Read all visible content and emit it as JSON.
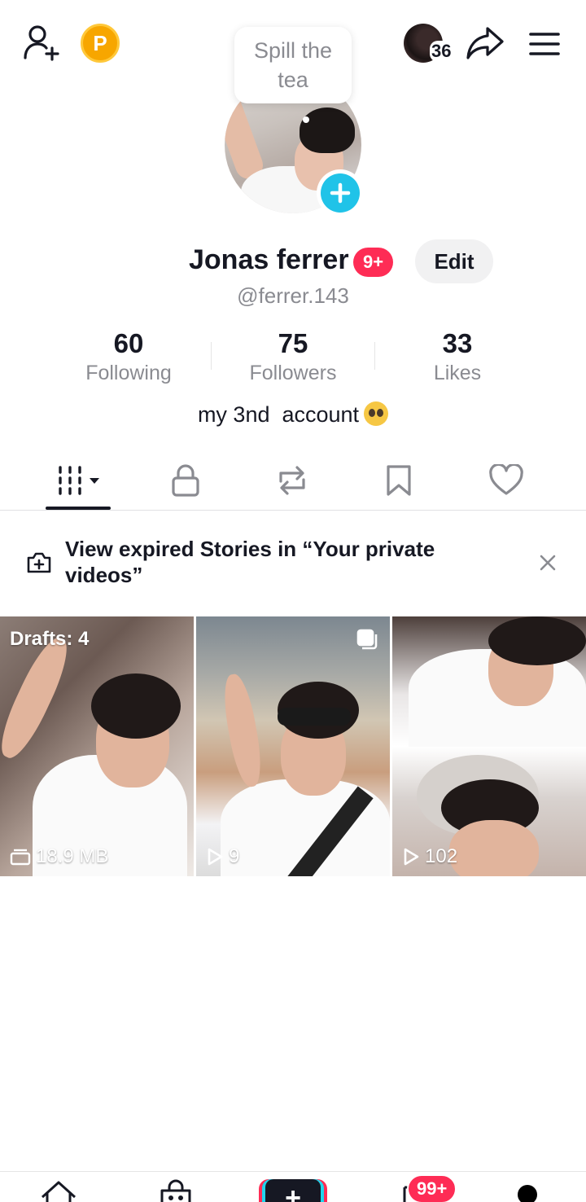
{
  "header": {
    "coin_letter": "P",
    "story_count": "36"
  },
  "tooltip": {
    "text": "Spill the tea"
  },
  "profile": {
    "name": "Jonas ferrer",
    "notification_badge": "9+",
    "edit_label": "Edit",
    "handle": "@ferrer.143",
    "bio": "my 3nd  account"
  },
  "stats": [
    {
      "value": "60",
      "label": "Following"
    },
    {
      "value": "75",
      "label": "Followers"
    },
    {
      "value": "33",
      "label": "Likes"
    }
  ],
  "tabs": [
    {
      "icon": "grid-icon",
      "selected": true
    },
    {
      "icon": "lock-icon"
    },
    {
      "icon": "repost-icon"
    },
    {
      "icon": "bookmark-icon"
    },
    {
      "icon": "heart-icon"
    }
  ],
  "banner": {
    "text": "View expired Stories in “Your private videos”"
  },
  "videos": [
    {
      "top_label": "Drafts: 4",
      "bottom_label": "18.9 MB",
      "bottom_icon": "drafts-stack-icon"
    },
    {
      "bottom_label": "9",
      "bottom_icon": "play-icon",
      "corner_icon": "multi-photo-icon"
    },
    {
      "bottom_label": "102",
      "bottom_icon": "play-icon"
    }
  ],
  "bottom_nav": {
    "inbox_badge": "99+",
    "create_symbol": "+"
  },
  "colors": {
    "accent_red": "#fe2c55",
    "accent_cyan": "#20d5ec",
    "badge_blue": "#20c3e8",
    "coin_gold": "#f7a600"
  }
}
